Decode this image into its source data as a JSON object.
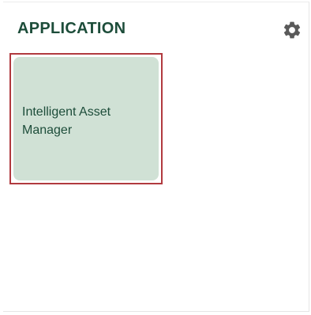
{
  "header": {
    "title": "APPLICATION",
    "settings_icon": "gear-icon"
  },
  "applications": [
    {
      "label": "Intelligent Asset Manager",
      "selected": true
    }
  ],
  "colors": {
    "title_text": "#1d4d3a",
    "tile_background": "#d0e1d5",
    "selection_border": "#b13a3f",
    "icon": "#5a5a5a"
  }
}
